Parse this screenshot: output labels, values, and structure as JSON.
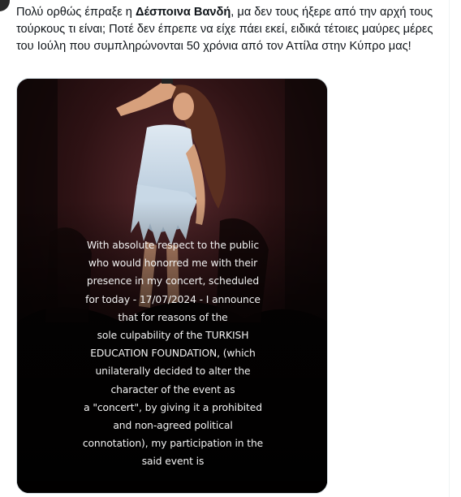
{
  "tweet": {
    "text_before_name": "Πολύ ορθώς έπραξε η ",
    "name": "Δέσποινα Βανδή",
    "text_after_name": ", μα δεν τους ήξερε από την αρχή τους τούρκους τι είναι; Ποτέ δεν έπρεπε να είχε πάει εκεί, ειδικά τέτοιες μαύρες μέρες του Ιούλη που συμπληρώνονται 50 χρόνια από τον Αττίλα στην Κύπρο μας!"
  },
  "media": {
    "overlay_lines": [
      "With absolute respect to the public",
      "who would honorred me with their",
      "presence in my concert, scheduled",
      "for today - 17/07/2024 - I announce",
      "that for reasons of the",
      "sole culpability of the TURKISH",
      "EDUCATION FOUNDATION, (which",
      "unilaterally decided to alter the",
      "character of the event as",
      "a \"concert\", by giving it a prohibited",
      "and non-agreed  political",
      "connotation), my participation in the",
      "said event is"
    ]
  }
}
